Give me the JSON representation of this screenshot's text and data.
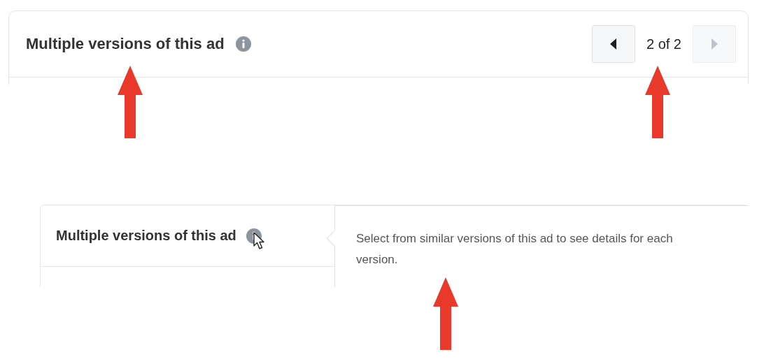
{
  "panels": [
    {
      "title": "Multiple versions of this ad",
      "pager": {
        "prev_disabled": false,
        "label": "2 of 2",
        "next_disabled": true
      }
    },
    {
      "title": "Multiple versions of this ad",
      "hovered_info": true,
      "tooltip": "Select from similar versions of this ad to see details for each version."
    }
  ],
  "annotations": [
    {
      "kind": "arrow"
    },
    {
      "kind": "arrow"
    },
    {
      "kind": "arrow"
    }
  ]
}
